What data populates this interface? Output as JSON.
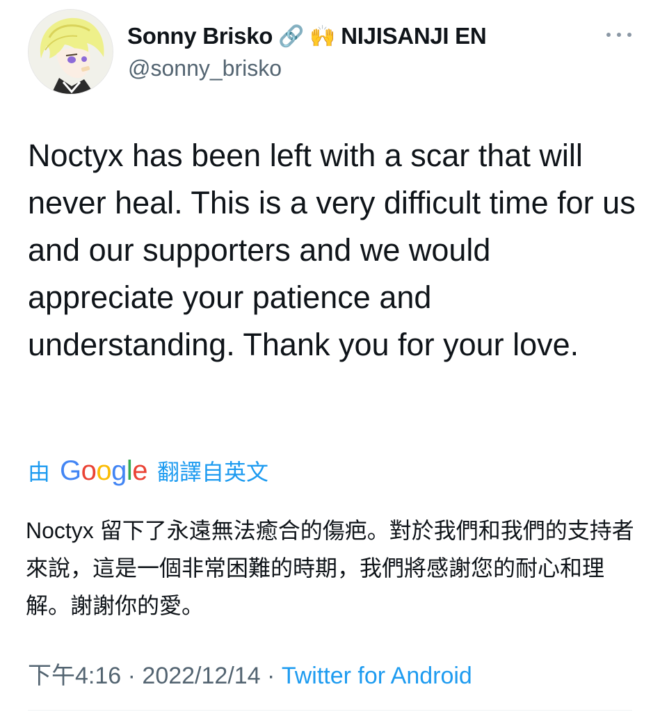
{
  "author": {
    "display_name": "Sonny Brisko",
    "badges": [
      "🔗",
      "🙌"
    ],
    "affiliation": "NIJISANJI EN",
    "handle": "@sonny_brisko"
  },
  "tweet": {
    "text": "Noctyx has been left with a scar that will never heal. This is a very difficult time for us and our supporters and we would appreciate your patience and understanding. Thank you for your love."
  },
  "translation": {
    "prefix": "由",
    "provider": "Google",
    "suffix": "翻譯自英文",
    "text": "Noctyx 留下了永遠無法癒合的傷疤。對於我們和我們的支持者來說，這是一個非常困難的時期，我們將感謝您的耐心和理解。謝謝你的愛。"
  },
  "meta": {
    "time": "下午4:16",
    "date": "2022/12/14",
    "source": "Twitter for Android",
    "separator": "·"
  },
  "colors": {
    "link": "#1d9bf0",
    "secondary_text": "#536471",
    "primary_text": "#0f1419"
  }
}
